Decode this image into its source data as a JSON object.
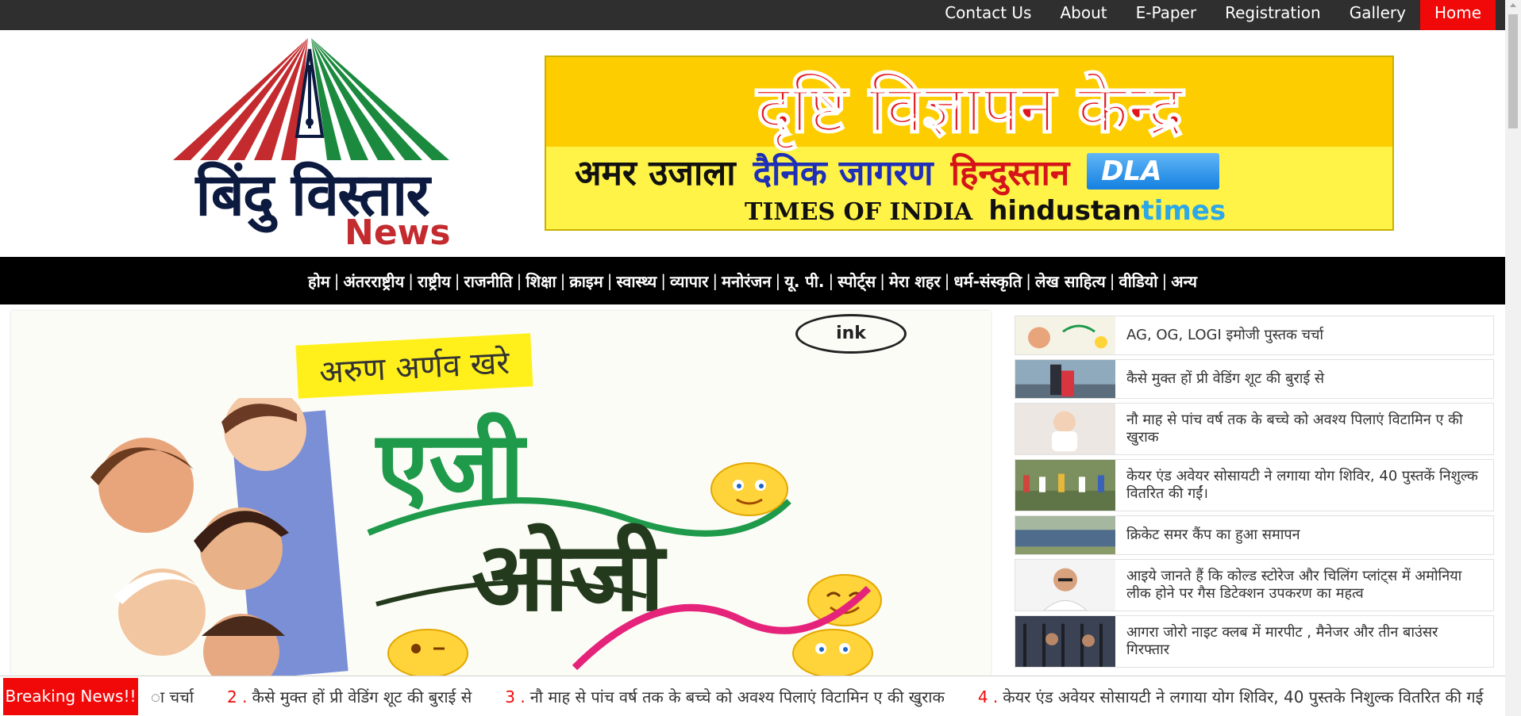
{
  "top_nav": {
    "items": [
      {
        "label": "Contact Us"
      },
      {
        "label": "About"
      },
      {
        "label": "E-Paper"
      },
      {
        "label": "Registration"
      },
      {
        "label": "Gallery"
      },
      {
        "label": "Home",
        "active": true
      }
    ]
  },
  "logo": {
    "title": "बिंदु विस्तार",
    "subtitle": "News"
  },
  "ad_banner": {
    "title": "दृष्टि विज्ञापन केन्द्र",
    "papers_row1": [
      "अमर उजाला",
      "दैनिक जागरण",
      "हिन्दुस्तान",
      "DLA"
    ],
    "papers_row2_toi": "TIMES OF INDIA",
    "papers_row2_ht_a": "hindustan",
    "papers_row2_ht_b": "times"
  },
  "category_nav": {
    "items": [
      "होम",
      "अंतरराष्ट्रीय",
      "राष्ट्रीय",
      "राजनीति",
      "शिक्षा",
      "क्राइम",
      "स्वास्थ्य",
      "व्यापार",
      "मनोरंजन",
      "यू. पी.",
      "स्पोर्ट्स",
      "मेरा शहर",
      "धर्म-संस्कृति",
      "लेख साहित्य",
      "वीडियो",
      "अन्य"
    ],
    "separator": "|"
  },
  "hero": {
    "author": "अरुण अर्णव खरे",
    "badge": "ink",
    "title_line1": "एजी",
    "title_line2": "ओजी"
  },
  "sidebar_news": [
    {
      "title": "AG, OG, LOGI इमोजी पुस्तक चर्चा"
    },
    {
      "title": "कैसे मुक्त हों प्री वेडिंग शूट की बुराई से"
    },
    {
      "title": "नौ माह से पांच वर्ष तक के बच्चे को अवश्य पिलाएं विटामिन ए की खुराक"
    },
    {
      "title": "केयर एंड अवेयर सोसायटी ने लगाया योग शिविर, 40 पुस्तकें निशुल्क वितरित की गईं।"
    },
    {
      "title": "क्रिकेट समर कैंप का हुआ समापन"
    },
    {
      "title": "आइये जानते हैं कि कोल्ड स्टोरेज और चिलिंग प्लांट्स में अमोनिया लीक होने पर गैस डिटेक्शन उपकरण का महत्व"
    },
    {
      "title": "आगरा जोरो नाइट क्लब में मारपीट , मैनेजर और तीन बाउंसर गिरफ्तार"
    }
  ],
  "breaking": {
    "label": "Breaking News!!",
    "ticker_lead": "ा चर्चा",
    "items": [
      {
        "num": "2 .",
        "text": "कैसे मुक्त हों प्री वेडिंग शूट की बुराई से"
      },
      {
        "num": "3 .",
        "text": "नौ माह से पांच वर्ष तक के बच्चे को अवश्य पिलाएं विटामिन ए की खुराक"
      },
      {
        "num": "4 .",
        "text": "केयर एंड अवेयर सोसायटी ने लगाया योग शिविर, 40 पुस्तके निशुल्क वितरित की गई"
      }
    ]
  },
  "colors": {
    "topbar": "#2f2f2f",
    "active": "#f10909",
    "catnav": "#000000",
    "logo_red": "#c32b2f",
    "logo_green": "#1c8a3e",
    "logo_navy": "#0d1a40"
  }
}
